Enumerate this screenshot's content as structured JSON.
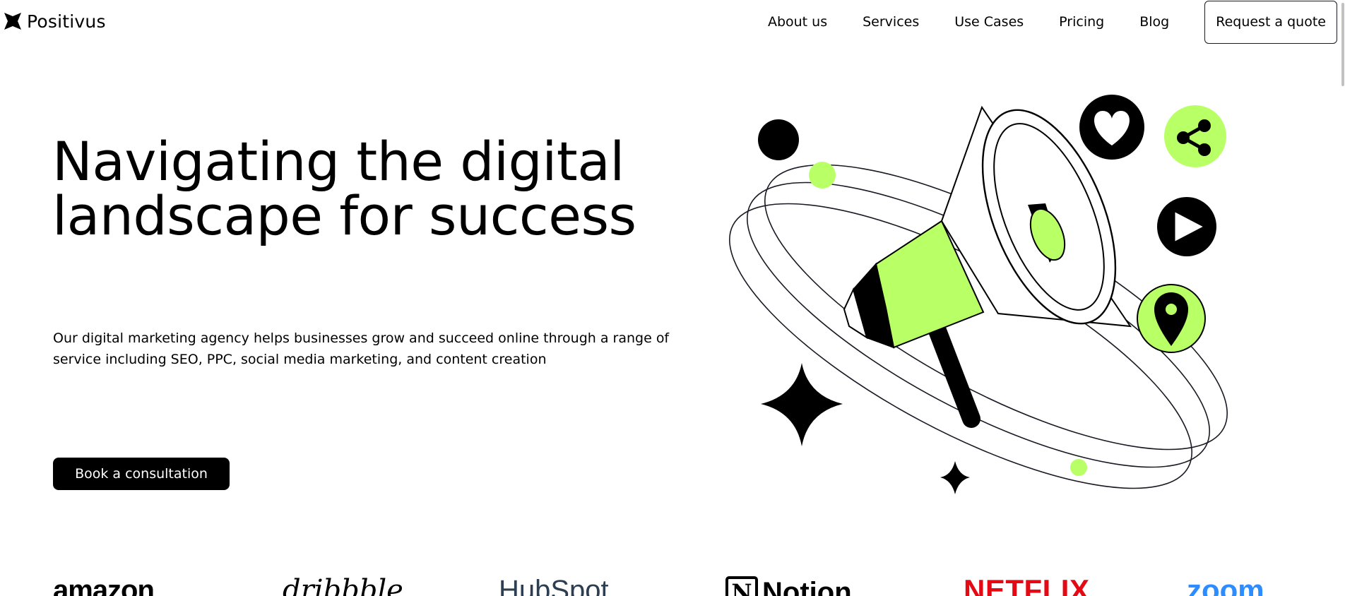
{
  "brand": {
    "name": "Positivus"
  },
  "nav": {
    "links": [
      "About us",
      "Services",
      "Use Cases",
      "Pricing",
      "Blog"
    ],
    "cta": "Request a quote"
  },
  "hero": {
    "title_line1": "Navigating the digital",
    "title_line2": "landscape for success",
    "description_line1": "Our digital marketing agency helps businesses grow and succeed online through a range of",
    "description_line2": "service including SEO, PPC, social media marketing, and content creation",
    "cta": "Book a consultation"
  },
  "illustration": {
    "icons": [
      "megaphone-icon",
      "heart-icon",
      "share-icon",
      "play-icon",
      "location-pin-icon",
      "sparkle-star-icon"
    ]
  },
  "logos": {
    "amazon": "amazon",
    "dribbble": "dribbble",
    "hubspot": "HubSpot",
    "notion_mark": "N",
    "notion": "Notion",
    "netflix": "NETFLIX",
    "zoom": "zoom"
  },
  "colors": {
    "accent": "#b9ff66",
    "dark": "#191a23",
    "background": "#ffffff"
  }
}
